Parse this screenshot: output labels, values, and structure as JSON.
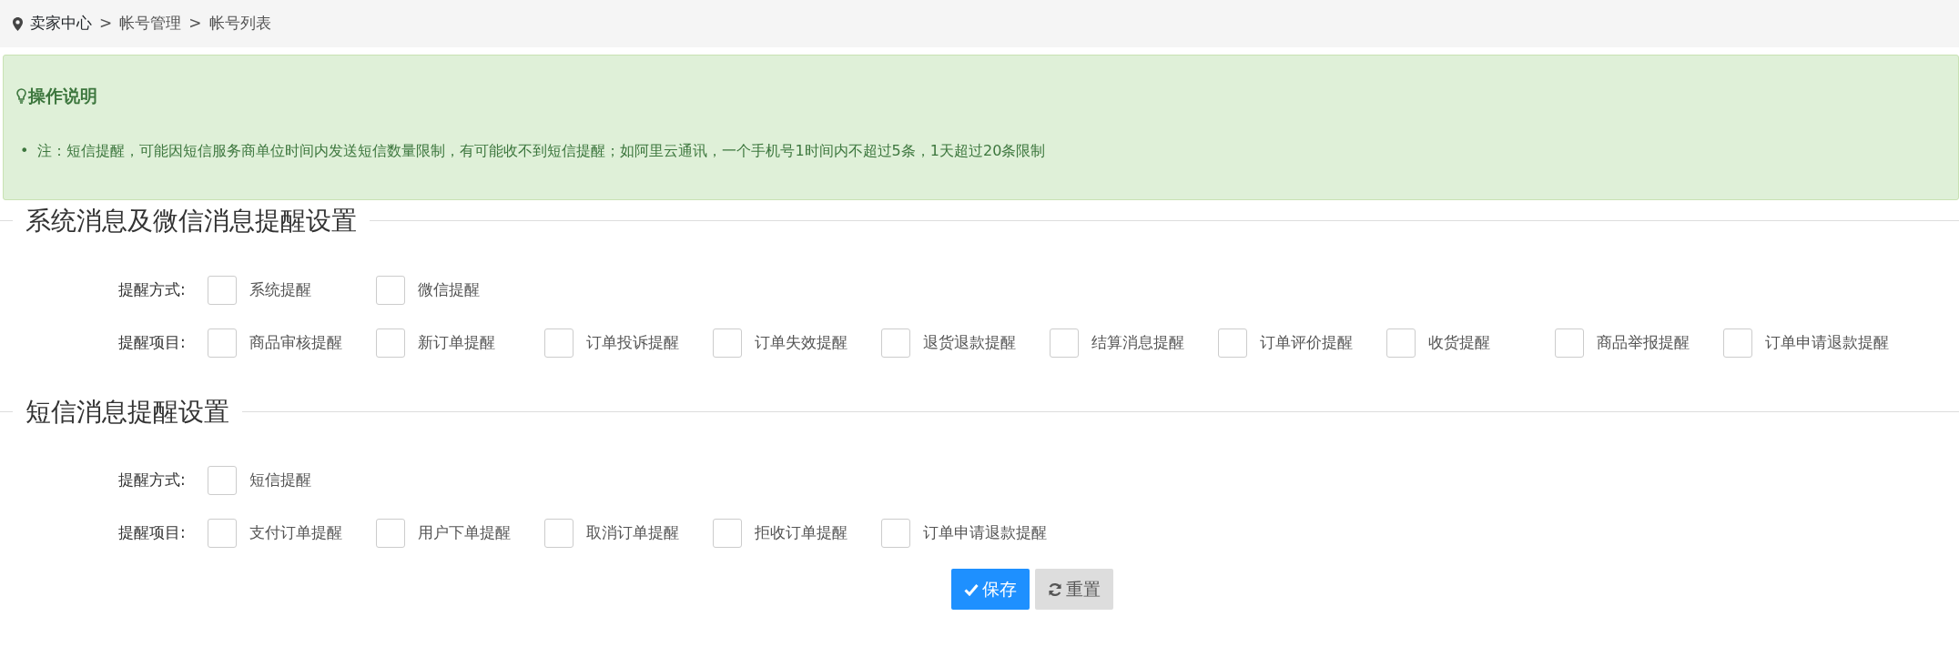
{
  "breadcrumb": [
    "卖家中心",
    "帐号管理",
    "帐号列表"
  ],
  "breadcrumb_separator": ">",
  "notice": {
    "title": "操作说明",
    "bullet": "•",
    "items": [
      "注：短信提醒，可能因短信服务商单位时间内发送短信数量限制，有可能收不到短信提醒；如阿里云通讯，一个手机号1时间内不超过5条，1天超过20条限制"
    ]
  },
  "sections": [
    {
      "title": "系统消息及微信消息提醒设置",
      "rows": [
        {
          "label": "提醒方式:",
          "options": [
            {
              "label": "系统提醒",
              "checked": false
            },
            {
              "label": "微信提醒",
              "checked": false
            }
          ]
        },
        {
          "label": "提醒项目:",
          "options": [
            {
              "label": "商品审核提醒",
              "checked": false
            },
            {
              "label": "新订单提醒",
              "checked": false
            },
            {
              "label": "订单投诉提醒",
              "checked": false
            },
            {
              "label": "订单失效提醒",
              "checked": false
            },
            {
              "label": "退货退款提醒",
              "checked": false
            },
            {
              "label": "结算消息提醒",
              "checked": false
            },
            {
              "label": "订单评价提醒",
              "checked": false
            },
            {
              "label": "收货提醒",
              "checked": false
            },
            {
              "label": "商品举报提醒",
              "checked": false
            },
            {
              "label": "订单申请退款提醒",
              "checked": false
            }
          ]
        }
      ]
    },
    {
      "title": "短信消息提醒设置",
      "rows": [
        {
          "label": "提醒方式:",
          "options": [
            {
              "label": "短信提醒",
              "checked": false
            }
          ]
        },
        {
          "label": "提醒项目:",
          "options": [
            {
              "label": "支付订单提醒",
              "checked": false
            },
            {
              "label": "用户下单提醒",
              "checked": false
            },
            {
              "label": "取消订单提醒",
              "checked": false
            },
            {
              "label": "拒收订单提醒",
              "checked": false
            },
            {
              "label": "订单申请退款提醒",
              "checked": false
            }
          ]
        }
      ]
    }
  ],
  "buttons": [
    {
      "kind": "primary",
      "label": "保存"
    },
    {
      "kind": "secondary",
      "label": "重置"
    }
  ]
}
